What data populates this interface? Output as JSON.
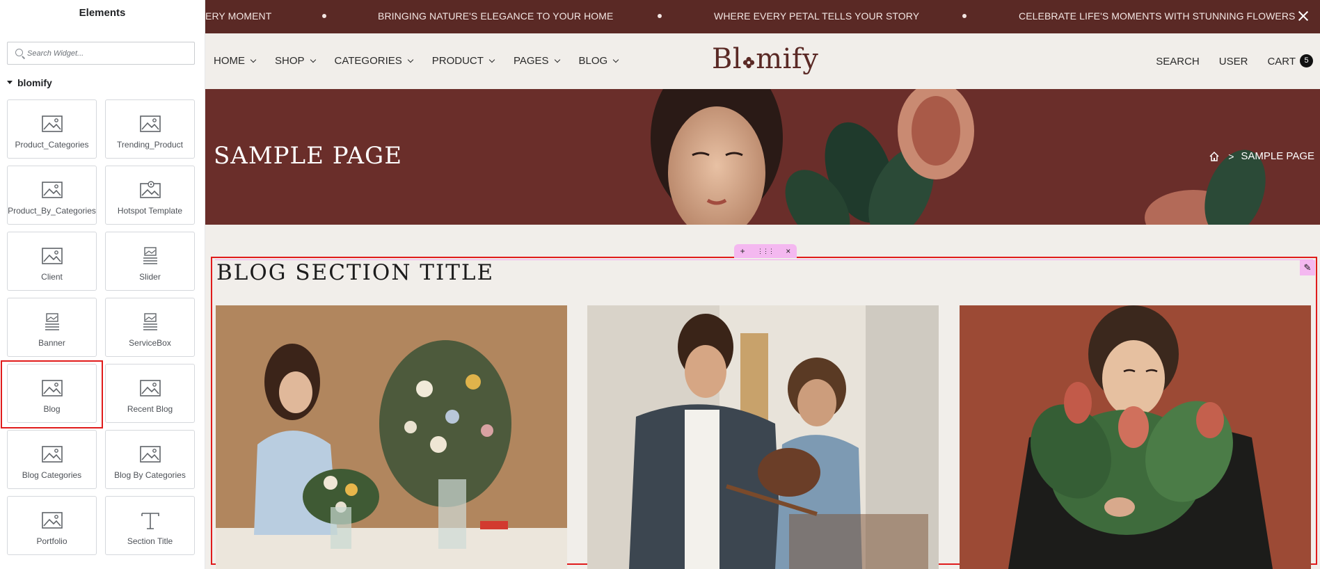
{
  "panel": {
    "title": "Elements",
    "search_placeholder": "Search Widget...",
    "category": "blomify",
    "widgets": [
      {
        "label": "Product_Categories",
        "icon": "image-icon"
      },
      {
        "label": "Trending_Product",
        "icon": "image-icon"
      },
      {
        "label": "Product_By_Categories",
        "icon": "image-icon"
      },
      {
        "label": "Hotspot Template",
        "icon": "image-hotspot-icon"
      },
      {
        "label": "Client",
        "icon": "image-icon"
      },
      {
        "label": "Slider",
        "icon": "slides-icon"
      },
      {
        "label": "Banner",
        "icon": "slides-icon"
      },
      {
        "label": "ServiceBox",
        "icon": "slides-icon"
      },
      {
        "label": "Blog",
        "icon": "image-icon",
        "selected": true
      },
      {
        "label": "Recent Blog",
        "icon": "image-icon"
      },
      {
        "label": "Blog Categories",
        "icon": "image-icon"
      },
      {
        "label": "Blog By Categories",
        "icon": "image-icon"
      },
      {
        "label": "Portfolio",
        "icon": "image-icon"
      },
      {
        "label": "Section Title",
        "icon": "text-T-icon"
      }
    ]
  },
  "ticker": {
    "items": [
      "ERY MOMENT",
      "BRINGING NATURE'S ELEGANCE TO YOUR HOME",
      "WHERE EVERY PETAL TELLS YOUR STORY",
      "CELEBRATE LIFE'S MOMENTS WITH STUNNING FLOWERS"
    ]
  },
  "nav": {
    "menu": [
      "HOME",
      "SHOP",
      "CATEGORIES",
      "PRODUCT",
      "PAGES",
      "BLOG"
    ],
    "logo_left": "Bl",
    "logo_right": "mify",
    "search": "SEARCH",
    "user": "USER",
    "cart": "CART",
    "cart_count": "5"
  },
  "hero": {
    "title": "SAMPLE PAGE",
    "breadcrumb_current": "SAMPLE PAGE"
  },
  "section": {
    "title": "BLOG SECTION TITLE",
    "toolbar": [
      "+",
      "⋮⋮⋮",
      "×"
    ],
    "edit_icon": "✎"
  },
  "colors": {
    "brand": "#5a2925",
    "selection": "#e01b1b",
    "handle": "#f4b8f0"
  }
}
